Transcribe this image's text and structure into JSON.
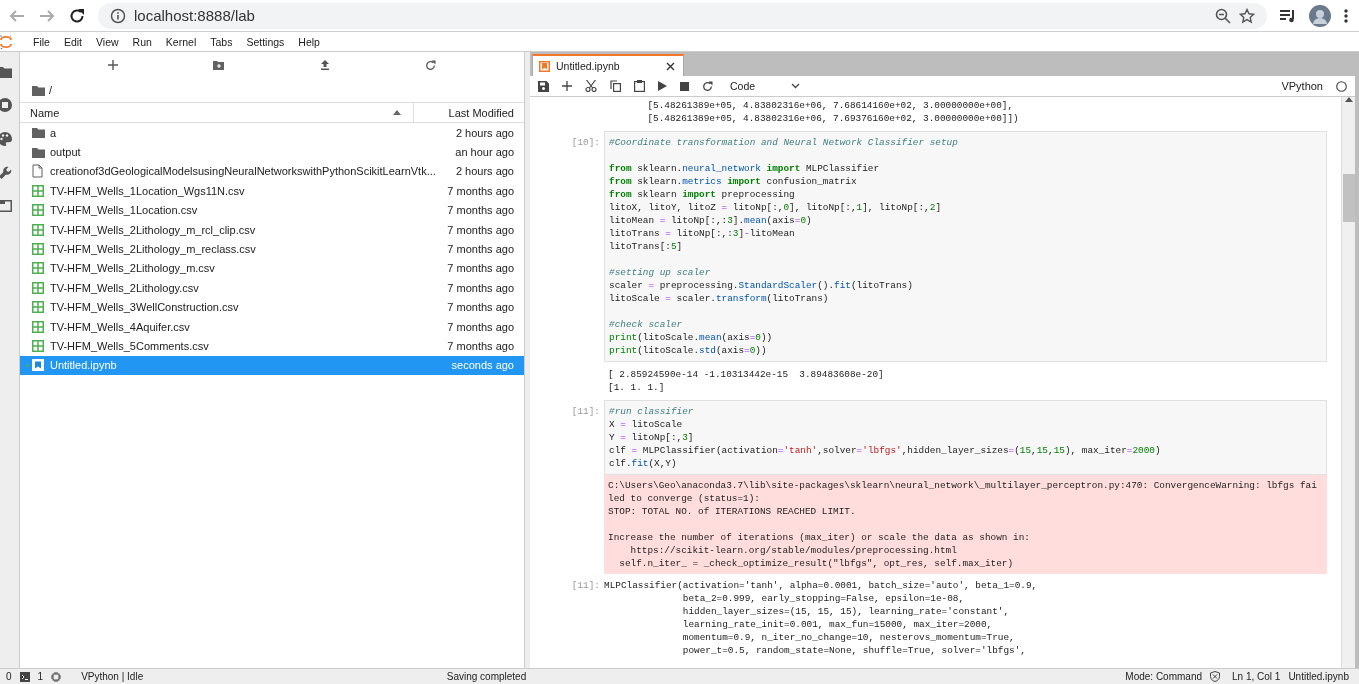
{
  "browser": {
    "url": "localhost:8888/lab"
  },
  "menu": [
    "File",
    "Edit",
    "View",
    "Run",
    "Kernel",
    "Tabs",
    "Settings",
    "Help"
  ],
  "file_browser": {
    "path": "/",
    "columns": [
      "Name",
      "Last Modified"
    ],
    "items": [
      {
        "name": "a",
        "modified": "2 hours ago",
        "kind": "folder",
        "selected": false,
        "running": false
      },
      {
        "name": "output",
        "modified": "an hour ago",
        "kind": "folder",
        "selected": false,
        "running": false
      },
      {
        "name": "creationof3dGeologicalModelsusingNeuralNetworkswithPythonScikitLearnVtk...",
        "modified": "2 hours ago",
        "kind": "file",
        "selected": false,
        "running": false
      },
      {
        "name": "TV-HFM_Wells_1Location_Wgs11N.csv",
        "modified": "7 months ago",
        "kind": "csv",
        "selected": false,
        "running": false
      },
      {
        "name": "TV-HFM_Wells_1Location.csv",
        "modified": "7 months ago",
        "kind": "csv",
        "selected": false,
        "running": false
      },
      {
        "name": "TV-HFM_Wells_2Lithology_m_rcl_clip.csv",
        "modified": "7 months ago",
        "kind": "csv",
        "selected": false,
        "running": false
      },
      {
        "name": "TV-HFM_Wells_2Lithology_m_reclass.csv",
        "modified": "7 months ago",
        "kind": "csv",
        "selected": false,
        "running": false
      },
      {
        "name": "TV-HFM_Wells_2Lithology_m.csv",
        "modified": "7 months ago",
        "kind": "csv",
        "selected": false,
        "running": false
      },
      {
        "name": "TV-HFM_Wells_2Lithology.csv",
        "modified": "7 months ago",
        "kind": "csv",
        "selected": false,
        "running": false
      },
      {
        "name": "TV-HFM_Wells_3WellConstruction.csv",
        "modified": "7 months ago",
        "kind": "csv",
        "selected": false,
        "running": false
      },
      {
        "name": "TV-HFM_Wells_4Aquifer.csv",
        "modified": "7 months ago",
        "kind": "csv",
        "selected": false,
        "running": false
      },
      {
        "name": "TV-HFM_Wells_5Comments.csv",
        "modified": "7 months ago",
        "kind": "csv",
        "selected": false,
        "running": false
      },
      {
        "name": "Untitled.ipynb",
        "modified": "seconds ago",
        "kind": "notebook",
        "selected": true,
        "running": true
      }
    ]
  },
  "notebook": {
    "tab": {
      "title": "Untitled.ipynb",
      "selected": true
    },
    "cell_type": "Code",
    "kernel": "VPython",
    "top_output": [
      "       [5.48261389e+05, 4.83802316e+06, 7.68614160e+02, 3.00000000e+00],",
      "       [5.48261389e+05, 4.83802316e+06, 7.69376160e+02, 3.00000000e+00]])"
    ],
    "cells": [
      {
        "prompt": "[10]:",
        "blocks": [
          [
            [
              {
                "kind": "cm",
                "text": "#Coordinate transformation and Neural Network Classifier setup"
              }
            ]
          ],
          [
            [
              {
                "kind": "kw",
                "text": "from"
              },
              {
                "kind": "p",
                "text": " sklearn."
              },
              {
                "kind": "at",
                "text": "neural_network"
              },
              {
                "kind": "kw",
                "text": " import"
              },
              {
                "kind": "p",
                "text": " MLPClassifier"
              }
            ],
            [
              {
                "kind": "kw",
                "text": "from"
              },
              {
                "kind": "p",
                "text": " sklearn."
              },
              {
                "kind": "at",
                "text": "metrics"
              },
              {
                "kind": "kw",
                "text": " import"
              },
              {
                "kind": "p",
                "text": " confusion_matrix"
              }
            ],
            [
              {
                "kind": "kw",
                "text": "from"
              },
              {
                "kind": "p",
                "text": " sklearn "
              },
              {
                "kind": "kw",
                "text": "import"
              },
              {
                "kind": "p",
                "text": " preprocessing"
              }
            ],
            [
              {
                "kind": "p",
                "text": "litoX, litoY, litoZ "
              },
              {
                "kind": "op",
                "text": "="
              },
              {
                "kind": "p",
                "text": " litoNp[:,"
              },
              {
                "kind": "nm",
                "text": "0"
              },
              {
                "kind": "p",
                "text": "], litoNp[:,"
              },
              {
                "kind": "nm",
                "text": "1"
              },
              {
                "kind": "p",
                "text": "], litoNp[:,"
              },
              {
                "kind": "nm",
                "text": "2"
              },
              {
                "kind": "p",
                "text": "]"
              }
            ],
            [
              {
                "kind": "p",
                "text": "litoMean "
              },
              {
                "kind": "op",
                "text": "="
              },
              {
                "kind": "p",
                "text": " litoNp[:,:"
              },
              {
                "kind": "nm",
                "text": "3"
              },
              {
                "kind": "p",
                "text": "]."
              },
              {
                "kind": "at",
                "text": "mean"
              },
              {
                "kind": "p",
                "text": "(axis"
              },
              {
                "kind": "op",
                "text": "="
              },
              {
                "kind": "nm",
                "text": "0"
              },
              {
                "kind": "p",
                "text": ")"
              }
            ],
            [
              {
                "kind": "p",
                "text": "litoTrans "
              },
              {
                "kind": "op",
                "text": "="
              },
              {
                "kind": "p",
                "text": " litoNp[:,:"
              },
              {
                "kind": "nm",
                "text": "3"
              },
              {
                "kind": "p",
                "text": "]"
              },
              {
                "kind": "op",
                "text": "-"
              },
              {
                "kind": "p",
                "text": "litoMean"
              }
            ],
            [
              {
                "kind": "p",
                "text": "litoTrans[:"
              },
              {
                "kind": "nm",
                "text": "5"
              },
              {
                "kind": "p",
                "text": "]"
              }
            ]
          ],
          [
            [
              {
                "kind": "cm",
                "text": "#setting up scaler"
              }
            ],
            [
              {
                "kind": "p",
                "text": "scaler "
              },
              {
                "kind": "op",
                "text": "="
              },
              {
                "kind": "p",
                "text": " preprocessing."
              },
              {
                "kind": "at",
                "text": "StandardScaler"
              },
              {
                "kind": "p",
                "text": "()."
              },
              {
                "kind": "at",
                "text": "fit"
              },
              {
                "kind": "p",
                "text": "(litoTrans)"
              }
            ],
            [
              {
                "kind": "p",
                "text": "litoScale "
              },
              {
                "kind": "op",
                "text": "="
              },
              {
                "kind": "p",
                "text": " scaler."
              },
              {
                "kind": "at",
                "text": "transform"
              },
              {
                "kind": "p",
                "text": "(litoTrans)"
              }
            ]
          ],
          [
            [
              {
                "kind": "cm",
                "text": "#check scaler"
              }
            ],
            [
              {
                "kind": "bi",
                "text": "print"
              },
              {
                "kind": "p",
                "text": "(litoScale."
              },
              {
                "kind": "at",
                "text": "mean"
              },
              {
                "kind": "p",
                "text": "(axis"
              },
              {
                "kind": "op",
                "text": "="
              },
              {
                "kind": "nm",
                "text": "0"
              },
              {
                "kind": "p",
                "text": "))"
              }
            ],
            [
              {
                "kind": "bi",
                "text": "print"
              },
              {
                "kind": "p",
                "text": "(litoScale."
              },
              {
                "kind": "at",
                "text": "std"
              },
              {
                "kind": "p",
                "text": "(axis"
              },
              {
                "kind": "op",
                "text": "="
              },
              {
                "kind": "nm",
                "text": "0"
              },
              {
                "kind": "p",
                "text": "))"
              }
            ]
          ]
        ],
        "outputs": [
          {
            "kind": "stream",
            "paragraphs": [
              [
                "[ 2.85924590e-14 -1.10313442e-15  3.89483608e-20]",
                "[1. 1. 1.]"
              ]
            ]
          }
        ]
      },
      {
        "prompt": "[11]:",
        "blocks": [
          [
            [
              {
                "kind": "cm",
                "text": "#run classifier"
              }
            ],
            [
              {
                "kind": "p",
                "text": "X "
              },
              {
                "kind": "op",
                "text": "="
              },
              {
                "kind": "p",
                "text": " litoScale"
              }
            ],
            [
              {
                "kind": "p",
                "text": "Y "
              },
              {
                "kind": "op",
                "text": "="
              },
              {
                "kind": "p",
                "text": " litoNp[:,"
              },
              {
                "kind": "nm",
                "text": "3"
              },
              {
                "kind": "p",
                "text": "]"
              }
            ],
            [
              {
                "kind": "p",
                "text": "clf "
              },
              {
                "kind": "op",
                "text": "="
              },
              {
                "kind": "p",
                "text": " MLPClassifier(activation"
              },
              {
                "kind": "op",
                "text": "="
              },
              {
                "kind": "st",
                "text": "'tanh'"
              },
              {
                "kind": "p",
                "text": ",solver"
              },
              {
                "kind": "op",
                "text": "="
              },
              {
                "kind": "st",
                "text": "'lbfgs'"
              },
              {
                "kind": "p",
                "text": ",hidden_layer_sizes"
              },
              {
                "kind": "op",
                "text": "="
              },
              {
                "kind": "p",
                "text": "("
              },
              {
                "kind": "nm",
                "text": "15"
              },
              {
                "kind": "p",
                "text": ","
              },
              {
                "kind": "nm",
                "text": "15"
              },
              {
                "kind": "p",
                "text": ","
              },
              {
                "kind": "nm",
                "text": "15"
              },
              {
                "kind": "p",
                "text": "), max_iter"
              },
              {
                "kind": "op",
                "text": "="
              },
              {
                "kind": "nm",
                "text": "2000"
              },
              {
                "kind": "p",
                "text": ")"
              }
            ],
            [
              {
                "kind": "p",
                "text": "clf."
              },
              {
                "kind": "at",
                "text": "fit"
              },
              {
                "kind": "p",
                "text": "(X,Y)"
              }
            ]
          ]
        ],
        "outputs": [
          {
            "kind": "error",
            "paragraphs": [
              [
                "C:\\Users\\Geo\\anaconda3.7\\lib\\site-packages\\sklearn\\neural_network\\_multilayer_perceptron.py:470: ConvergenceWarning: lbfgs fai",
                "led to converge (status=1):",
                "STOP: TOTAL NO. of ITERATIONS REACHED LIMIT."
              ],
              [
                "Increase the number of iterations (max_iter) or scale the data as shown in:",
                "    https://scikit-learn.org/stable/modules/preprocessing.html",
                "  self.n_iter_ = _check_optimize_result(\"lbfgs\", opt_res, self.max_iter)"
              ]
            ]
          },
          {
            "kind": "result",
            "prompt": "[11]:",
            "paragraphs": [
              [
                "MLPClassifier(activation='tanh', alpha=0.0001, batch_size='auto', beta_1=0.9,",
                "              beta_2=0.999, early_stopping=False, epsilon=1e-08,",
                "              hidden_layer_sizes=(15, 15, 15), learning_rate='constant',",
                "              learning_rate_init=0.001, max_fun=15000, max_iter=2000,",
                "              momentum=0.9, n_iter_no_change=10, nesterovs_momentum=True,",
                "              power_t=0.5, random_state=None, shuffle=True, solver='lbfgs',"
              ]
            ]
          }
        ]
      }
    ]
  },
  "status_bar": {
    "terminals": "0",
    "kernels": "1",
    "kernel_status": "VPython | Idle",
    "message": "Saving completed",
    "mode": "Mode: Command",
    "position": "Ln 1, Col 1",
    "file": "Untitled.ipynb"
  }
}
